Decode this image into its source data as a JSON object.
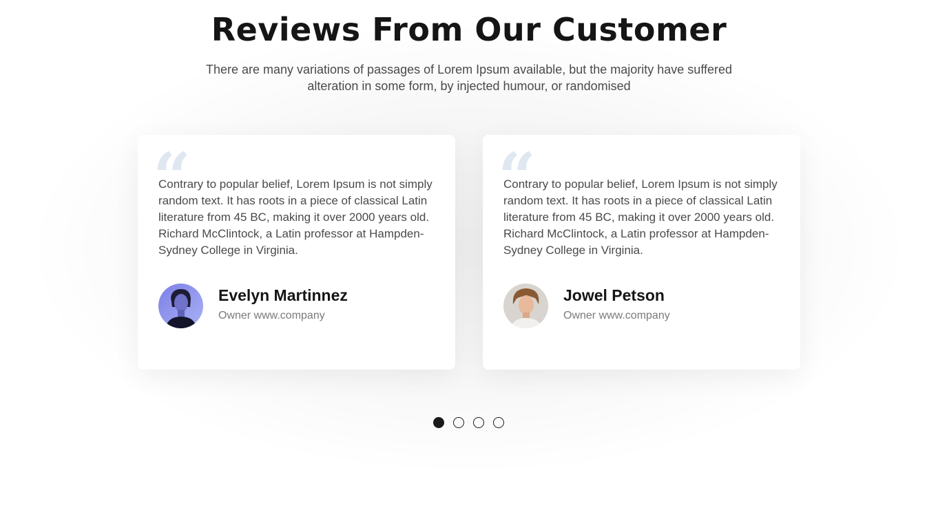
{
  "section": {
    "title": "Reviews From Our Customer",
    "subtitle": "There are many variations of passages of Lorem Ipsum available, but the majority have suffered alteration in some form, by injected humour, or randomised"
  },
  "reviews": [
    {
      "text": "Contrary to popular belief, Lorem Ipsum is not simply random text. It has roots in a piece of classical Latin literature from 45 BC, making it over 2000 years old. Richard McClintock, a Latin professor at Hampden-Sydney College in Virginia.",
      "name": "Evelyn Martinnez",
      "role": "Owner www.company",
      "avatar_icon": "woman-portrait-avatar"
    },
    {
      "text": "Contrary to popular belief, Lorem Ipsum is not simply random text. It has roots in a piece of classical Latin literature from 45 BC, making it over 2000 years old. Richard McClintock, a Latin professor at Hampden-Sydney College in Virginia.",
      "name": "Jowel Petson",
      "role": "Owner www.company",
      "avatar_icon": "man-portrait-avatar"
    }
  ],
  "quote_icon": "quote-icon",
  "pagination": {
    "total": 4,
    "active": 1
  },
  "colors": {
    "heading": "#151515",
    "body_text": "#4a4a4a",
    "muted_text": "#7a7a7a",
    "quote_mark": "#dfe7f1",
    "dot": "#1a1a1a"
  }
}
